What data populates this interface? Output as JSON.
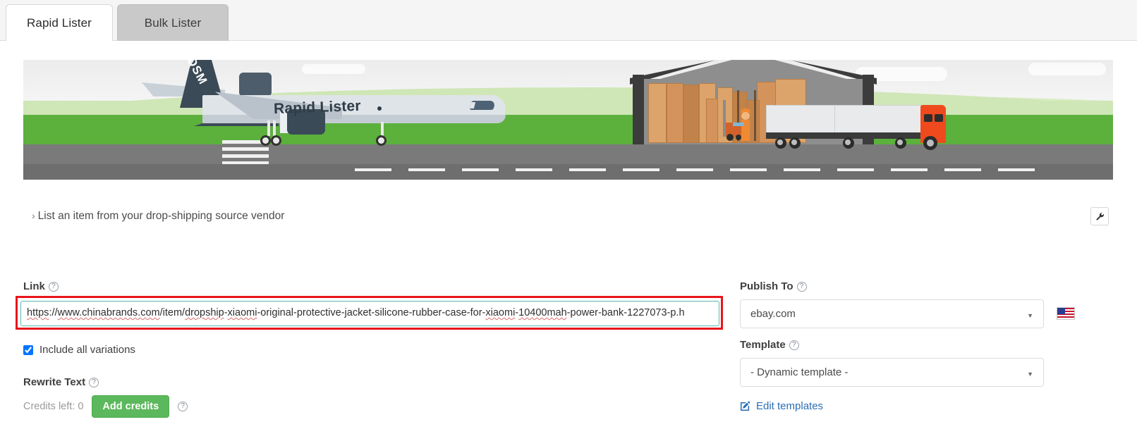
{
  "tabs": [
    {
      "label": "Rapid Lister",
      "active": true
    },
    {
      "label": "Bulk Lister",
      "active": false
    }
  ],
  "banner": {
    "plane_text": "Rapid Lister",
    "tail_text": "DSM",
    "scene": "airplane-landing-and-warehouse-loading-dock"
  },
  "section": {
    "toggle_label": "List an item from your drop-shipping source vendor",
    "chevron": "›",
    "tool_icon": "wrench-icon"
  },
  "form": {
    "link": {
      "label": "Link",
      "value": "https://www.chinabrands.com/item/dropship-xiaomi-original-protective-jacket-silicone-rubber-case-for-xiaomi-10400mah-power-bank-1227073-p.h",
      "placeholder": "",
      "segments": [
        {
          "t": "https",
          "sp": true
        },
        {
          "t": "://",
          "sp": false
        },
        {
          "t": "www.chinabrands.com",
          "sp": true
        },
        {
          "t": "/item/",
          "sp": false
        },
        {
          "t": "dropship",
          "sp": true
        },
        {
          "t": "-",
          "sp": false
        },
        {
          "t": "xiaomi",
          "sp": true
        },
        {
          "t": "-original-protective-jacket-silicone-rubber-case-for-",
          "sp": false
        },
        {
          "t": "xiaomi",
          "sp": true
        },
        {
          "t": "-",
          "sp": false
        },
        {
          "t": "10400mah",
          "sp": true
        },
        {
          "t": "-power-bank-1227073-p.h",
          "sp": false
        }
      ],
      "highlight_color": "#e8161c",
      "focus_border_color": "#5bb8ad"
    },
    "include_variations": {
      "label": "Include all variations",
      "checked": true
    },
    "rewrite_text": {
      "label": "Rewrite Text"
    },
    "credits": {
      "text": "Credits left: 0",
      "button_label": "Add credits",
      "button_color": "#5cb85c"
    }
  },
  "right": {
    "publish_to": {
      "label": "Publish To",
      "value": "ebay.com",
      "flag": "us-flag-icon"
    },
    "template": {
      "label": "Template",
      "value": "- Dynamic template -"
    },
    "edit_templates": {
      "label": "Edit templates",
      "icon": "edit-pencil-icon",
      "color": "#2a6fb5"
    }
  },
  "help_glyph": "?"
}
